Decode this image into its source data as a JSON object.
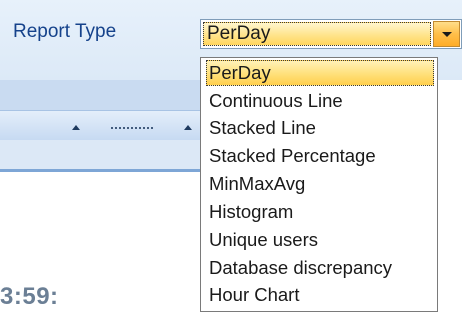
{
  "form": {
    "report_type_label": "Report Type"
  },
  "combo": {
    "value": "PerDay",
    "button_icon": "chevron-down-icon"
  },
  "dropdown": {
    "options": [
      "PerDay",
      "Continuous Line",
      "Stacked Line",
      "Stacked Percentage",
      "MinMaxAvg",
      "Histogram",
      "Unique users",
      "Database discrepancy",
      "Hour Chart"
    ],
    "selected_index": 0
  },
  "background": {
    "time_fragment": "3:59:"
  },
  "colors": {
    "label_text": "#15428b",
    "highlight": "#ffd65e",
    "band": "#c9dbf1"
  }
}
